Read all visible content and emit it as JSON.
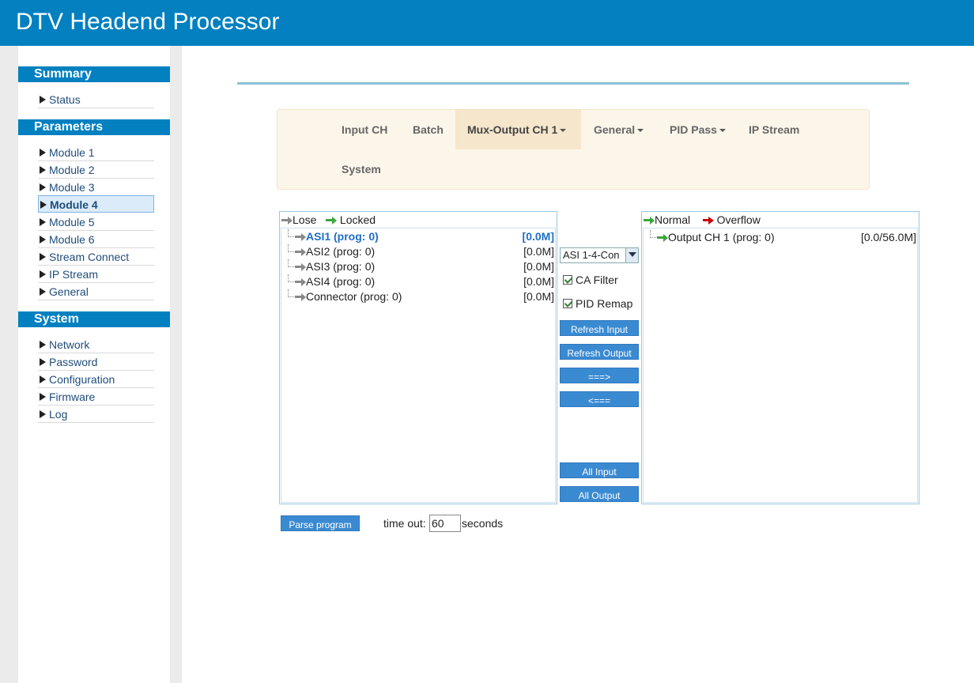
{
  "header": {
    "title": "DTV Headend Processor"
  },
  "sidebar": {
    "sections": [
      {
        "title": "Summary",
        "items": [
          "Status"
        ]
      },
      {
        "title": "Parameters",
        "items": [
          "Module 1",
          "Module 2",
          "Module 3",
          "Module 4",
          "Module 5",
          "Module 6",
          "Stream Connect",
          "IP Stream",
          "General"
        ]
      },
      {
        "title": "System",
        "items": [
          "Network",
          "Password",
          "Configuration",
          "Firmware",
          "Log"
        ]
      }
    ],
    "active": "Module 4"
  },
  "tabs": [
    {
      "label": "Input CH",
      "dropdown": false
    },
    {
      "label": "Batch",
      "dropdown": false
    },
    {
      "label": "Mux-Output CH 1",
      "dropdown": true,
      "active": true
    },
    {
      "label": "General",
      "dropdown": true
    },
    {
      "label": "PID Pass",
      "dropdown": true
    },
    {
      "label": "IP Stream",
      "dropdown": false
    },
    {
      "label": "System",
      "dropdown": false
    }
  ],
  "input_panel": {
    "legend": {
      "lose": "Lose",
      "locked": "Locked"
    },
    "rows": [
      {
        "name": "ASI1 (prog: 0)",
        "rate": "[0.0M]",
        "selected": true
      },
      {
        "name": "ASI2 (prog: 0)",
        "rate": "[0.0M]"
      },
      {
        "name": "ASI3 (prog: 0)",
        "rate": "[0.0M]"
      },
      {
        "name": "ASI4 (prog: 0)",
        "rate": "[0.0M]"
      },
      {
        "name": "Connector (prog: 0)",
        "rate": "[0.0M]"
      }
    ]
  },
  "controls": {
    "source_select": "ASI 1-4-Con",
    "ca_filter": {
      "label": "CA Filter",
      "checked": true
    },
    "pid_remap": {
      "label": "PID Remap",
      "checked": true
    },
    "buttons": {
      "refresh_input": "Refresh Input",
      "refresh_output": "Refresh Output",
      "add": "===>",
      "remove": "<===",
      "all_input": "All Input",
      "all_output": "All Output"
    }
  },
  "output_panel": {
    "legend": {
      "normal": "Normal",
      "overflow": "Overflow"
    },
    "rows": [
      {
        "name": "Output CH 1 (prog: 0)",
        "rate": "[0.0/56.0M]"
      }
    ]
  },
  "footer": {
    "parse_button": "Parse program",
    "timeout_label": "time out:",
    "timeout_value": "60",
    "seconds_label": "seconds"
  },
  "colors": {
    "header_bg": "#0280c0",
    "locked_arrow": "#3da63d",
    "overflow_arrow": "#cc0000",
    "selected_text": "#1e6ec8",
    "button_bg": "#3a8ad2"
  }
}
